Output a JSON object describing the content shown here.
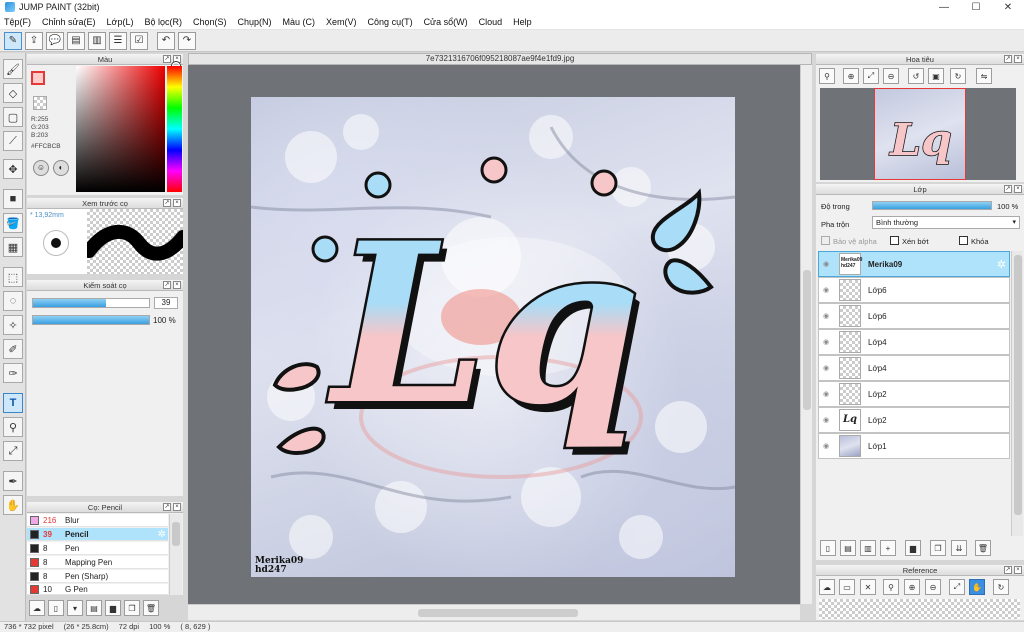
{
  "window": {
    "title": "JUMP PAINT (32bit)",
    "minimize": "—",
    "maximize": "☐",
    "close": "✕"
  },
  "menu": [
    "Tệp(F)",
    "Chỉnh sửa(E)",
    "Lớp(L)",
    "Bộ lọc(R)",
    "Chọn(S)",
    "Chụp(N)",
    "Màu (C)",
    "Xem(V)",
    "Công cụ(T)",
    "Cửa sổ(W)",
    "Cloud",
    "Help"
  ],
  "document": {
    "filename": "7e7321316706f095218087ae9f4e1fd9.jpg"
  },
  "color_panel": {
    "title": "Màu",
    "r": "R:255",
    "g": "G:203",
    "b": "B:203",
    "hex": "#FFCBCB",
    "fg_color": "#ffcbcb"
  },
  "brush_preview": {
    "title": "Xem trước cọ",
    "size": "* 13,92mm"
  },
  "brush_control": {
    "title": "Kiểm soát cọ",
    "size_value": "39",
    "opacity_value": "100 %",
    "size_fraction": 0.63,
    "opacity_fraction": 1.0
  },
  "brush_list": {
    "title": "Cọ: Pencil",
    "items": [
      {
        "size": "216",
        "name": "Blur",
        "color": "#f0a8e6"
      },
      {
        "size": "39",
        "name": "Pencil",
        "color": "#222222"
      },
      {
        "size": "8",
        "name": "Pen",
        "color": "#222222"
      },
      {
        "size": "8",
        "name": "Mapping Pen",
        "color": "#e53935"
      },
      {
        "size": "8",
        "name": "Pen (Sharp)",
        "color": "#222222"
      },
      {
        "size": "10",
        "name": "G Pen",
        "color": "#e53935"
      }
    ]
  },
  "navigator": {
    "title": "Hoa tiêu"
  },
  "layers_panel": {
    "title": "Lớp",
    "opacity_label": "Độ trong",
    "opacity_value": "100 %",
    "blend_label": "Pha trộn",
    "blend_value": "Bình thường",
    "protect_alpha": "Bảo vệ alpha",
    "clipping": "Xén bớt",
    "lock": "Khóa",
    "layers": [
      {
        "name": "Merika09",
        "thumb_text": "Merika09 hd247"
      },
      {
        "name": "Lớp6"
      },
      {
        "name": "Lớp6"
      },
      {
        "name": "Lớp4"
      },
      {
        "name": "Lớp4"
      },
      {
        "name": "Lớp2"
      },
      {
        "name": "Lớp2",
        "thumb_text": "Lq"
      },
      {
        "name": "Lớp1"
      }
    ]
  },
  "reference": {
    "title": "Reference"
  },
  "artwork": {
    "text": "Lq",
    "signature_line1": "Merika09",
    "signature_line2": "hd247"
  },
  "status": {
    "size": "736 * 732 pixel",
    "physical": "(26 * 25.8cm)",
    "dpi": "72 dpi",
    "zoom": "100 %",
    "coords": "( 8, 629 )"
  }
}
